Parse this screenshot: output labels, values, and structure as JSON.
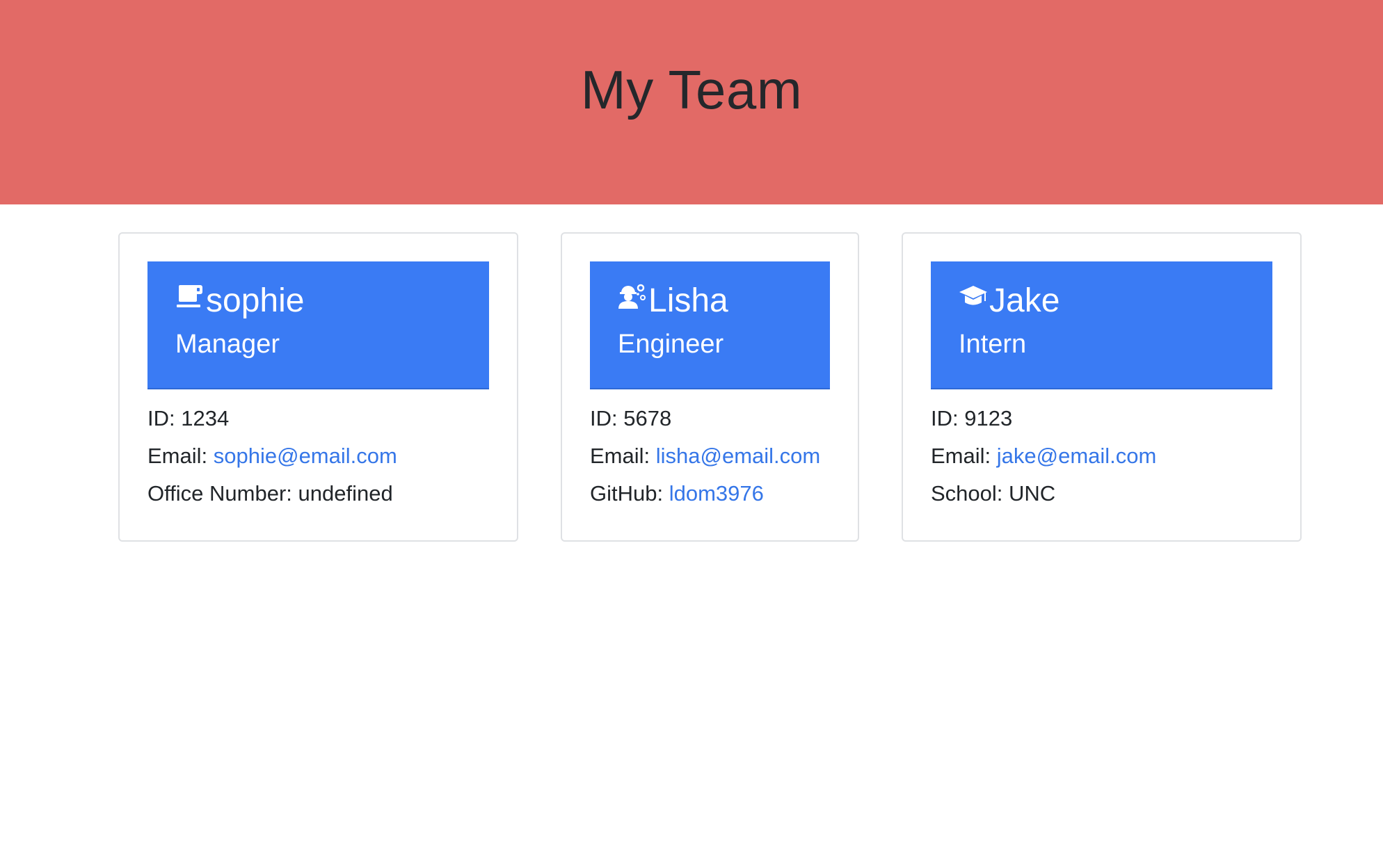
{
  "header": {
    "title": "My Team"
  },
  "colors": {
    "banner": "#e26a66",
    "card_header": "#3a7bf4",
    "link": "#3576e8"
  },
  "cards": [
    {
      "icon": "mug-icon",
      "name": "sophie",
      "role": "Manager",
      "id_label": "ID: ",
      "id": "1234",
      "email_label": "Email: ",
      "email": "sophie@email.com",
      "extra_label": "Office Number: ",
      "extra_value": "undefined"
    },
    {
      "icon": "engineer-icon",
      "name": "Lisha",
      "role": "Engineer",
      "id_label": "ID: ",
      "id": "5678",
      "email_label": "Email: ",
      "email": "lisha@email.com",
      "extra_label": "GitHub: ",
      "extra_value": "ldom3976"
    },
    {
      "icon": "graduation-cap-icon",
      "name": "Jake",
      "role": "Intern",
      "id_label": "ID: ",
      "id": "9123",
      "email_label": "Email: ",
      "email": "jake@email.com",
      "extra_label": "School: ",
      "extra_value": "UNC"
    }
  ]
}
